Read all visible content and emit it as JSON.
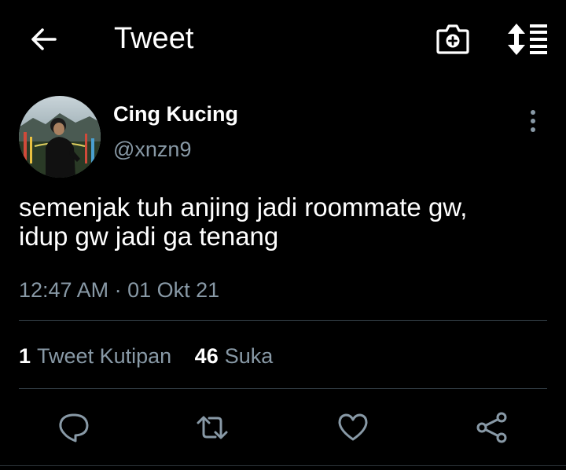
{
  "header": {
    "title": "Tweet",
    "back_icon": "arrow-left-icon",
    "camera_icon": "camera-plus-icon",
    "sort_icon": "sort-list-icon"
  },
  "tweet": {
    "author_name": "Cing Kucing",
    "author_handle": "@xnzn9",
    "text_lines": [
      "semenjak tuh anjing jadi roommate gw,",
      "idup gw jadi ga tenang"
    ],
    "time": "12:47 AM",
    "separator": "·",
    "date": "01 Okt 21"
  },
  "stats": {
    "quote_count": "1",
    "quote_label": "Tweet Kutipan",
    "like_count": "46",
    "like_label": "Suka"
  },
  "actions": {
    "reply_icon": "reply-icon",
    "retweet_icon": "retweet-icon",
    "like_icon": "heart-icon",
    "share_icon": "share-icon"
  },
  "colors": {
    "background": "#000000",
    "primary_text": "#ffffff",
    "secondary_text": "#8899a6",
    "divider": "#38444d"
  }
}
